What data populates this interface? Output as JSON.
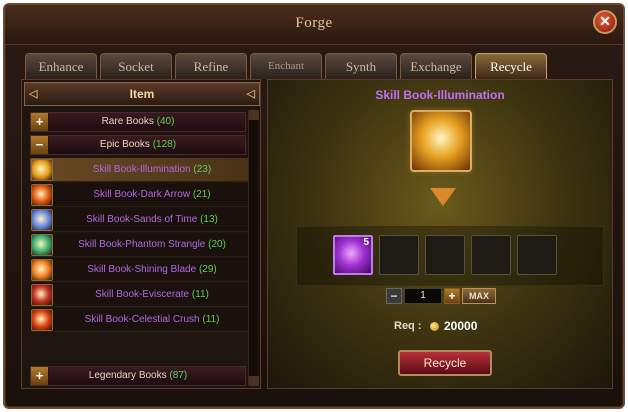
{
  "window": {
    "title": "Forge"
  },
  "tabs": [
    {
      "label": "Enhance",
      "active": false
    },
    {
      "label": "Socket",
      "active": false
    },
    {
      "label": "Refine",
      "active": false
    },
    {
      "label": "Enchant",
      "active": false
    },
    {
      "label": "Synth",
      "active": false
    },
    {
      "label": "Exchange",
      "active": false
    },
    {
      "label": "Recycle",
      "active": true
    }
  ],
  "left_panel": {
    "header": "Item",
    "categories": {
      "rare": {
        "label": "Rare Books",
        "count": "(40)",
        "toggle": "+"
      },
      "epic": {
        "label": "Epic Books",
        "count": "(128)",
        "toggle": "−"
      },
      "legendary": {
        "label": "Legendary Books",
        "count": "(87)",
        "toggle": "+"
      }
    },
    "books": [
      {
        "label": "Skill Book-Illumination",
        "count": "(23)",
        "selected": true,
        "icon": "illumination-icon",
        "color": "#e8a020"
      },
      {
        "label": "Skill Book-Dark Arrow",
        "count": "(21)",
        "selected": false,
        "icon": "dark-arrow-icon",
        "color": "#e05a10"
      },
      {
        "label": "Skill Book-Sands of Time",
        "count": "(13)",
        "selected": false,
        "icon": "sands-of-time-icon",
        "color": "#6a8ae0"
      },
      {
        "label": "Skill Book-Phantom Strangle",
        "count": "(20)",
        "selected": false,
        "icon": "phantom-strangle-icon",
        "color": "#3ab070"
      },
      {
        "label": "Skill Book-Shining Blade",
        "count": "(29)",
        "selected": false,
        "icon": "shining-blade-icon",
        "color": "#f08020"
      },
      {
        "label": "Skill Book-Eviscerate",
        "count": "(11)",
        "selected": false,
        "icon": "eviscerate-icon",
        "color": "#c03020"
      },
      {
        "label": "Skill Book-Celestial Crush",
        "count": "(11)",
        "selected": false,
        "icon": "celestial-crush-icon",
        "color": "#e04010"
      }
    ]
  },
  "right_panel": {
    "title": "Skill Book-Illumination",
    "output_slots": [
      {
        "filled": true,
        "count": "5",
        "icon": "purple-orb-icon"
      },
      {
        "filled": false
      },
      {
        "filled": false
      },
      {
        "filled": false
      },
      {
        "filled": false
      }
    ],
    "quantity": {
      "minus": "−",
      "value": "1",
      "plus": "+",
      "max_label": "MAX"
    },
    "requirement": {
      "label": "Req :",
      "value": "20000",
      "icon": "gold-coin-icon"
    },
    "action_label": "Recycle"
  },
  "colors": {
    "rarity_epic": "#b06ae0",
    "count_green": "#5fd05a",
    "accent_gold": "#c9a26a"
  }
}
